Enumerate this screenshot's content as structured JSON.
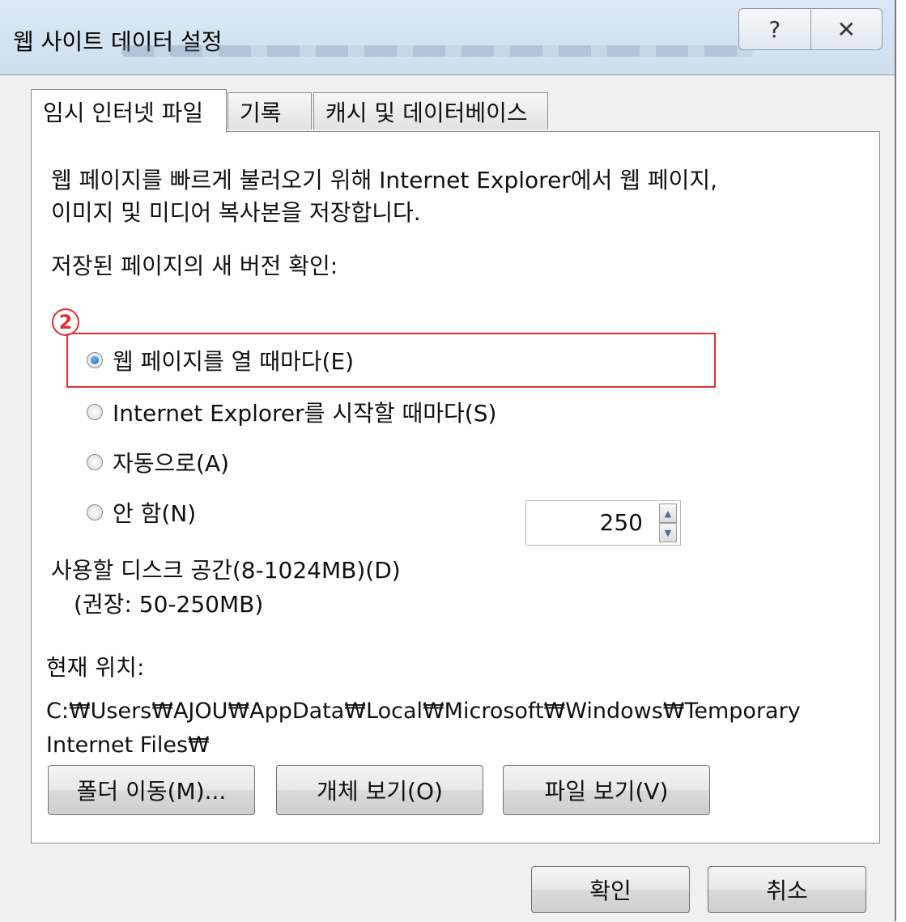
{
  "window": {
    "title": "웹 사이트 데이터 설정",
    "help_glyph": "?",
    "close_glyph": "✕"
  },
  "tabs": [
    {
      "label": "임시 인터넷 파일",
      "active": true
    },
    {
      "label": "기록",
      "active": false
    },
    {
      "label": "캐시 및 데이터베이스",
      "active": false
    }
  ],
  "panel": {
    "description_line1": "웹 페이지를 빠르게 불러오기 위해 Internet Explorer에서 웹 페이지,",
    "description_line2": "이미지 및 미디어 복사본을 저장합니다.",
    "check_label": "저장된 페이지의 새 버전 확인:",
    "step_marker": "2",
    "options": [
      {
        "label": "웹 페이지를 열 때마다(E)",
        "checked": true
      },
      {
        "label": "Internet Explorer를 시작할 때마다(S)",
        "checked": false
      },
      {
        "label": "자동으로(A)",
        "checked": false
      },
      {
        "label": "안 함(N)",
        "checked": false
      }
    ],
    "disk_label": "사용할 디스크 공간(8-1024MB)(D)",
    "disk_hint": "(권장: 50-250MB)",
    "disk_value": "250",
    "location_label": "현재 위치:",
    "location_line1": "C:₩Users₩AJOU₩AppData₩Local₩Microsoft₩Windows₩Temporary",
    "location_line2": "Internet Files₩",
    "buttons": {
      "move_folder": "폴더 이동(M)...",
      "view_objects": "개체 보기(O)",
      "view_files": "파일 보기(V)"
    }
  },
  "footer": {
    "ok": "확인",
    "cancel": "취소"
  },
  "colors": {
    "highlight": "#e03030",
    "titlebar": "#d6e3f1"
  },
  "icons": [
    "help-icon",
    "close-icon",
    "spin-up-icon",
    "spin-down-icon",
    "radio-icon"
  ]
}
